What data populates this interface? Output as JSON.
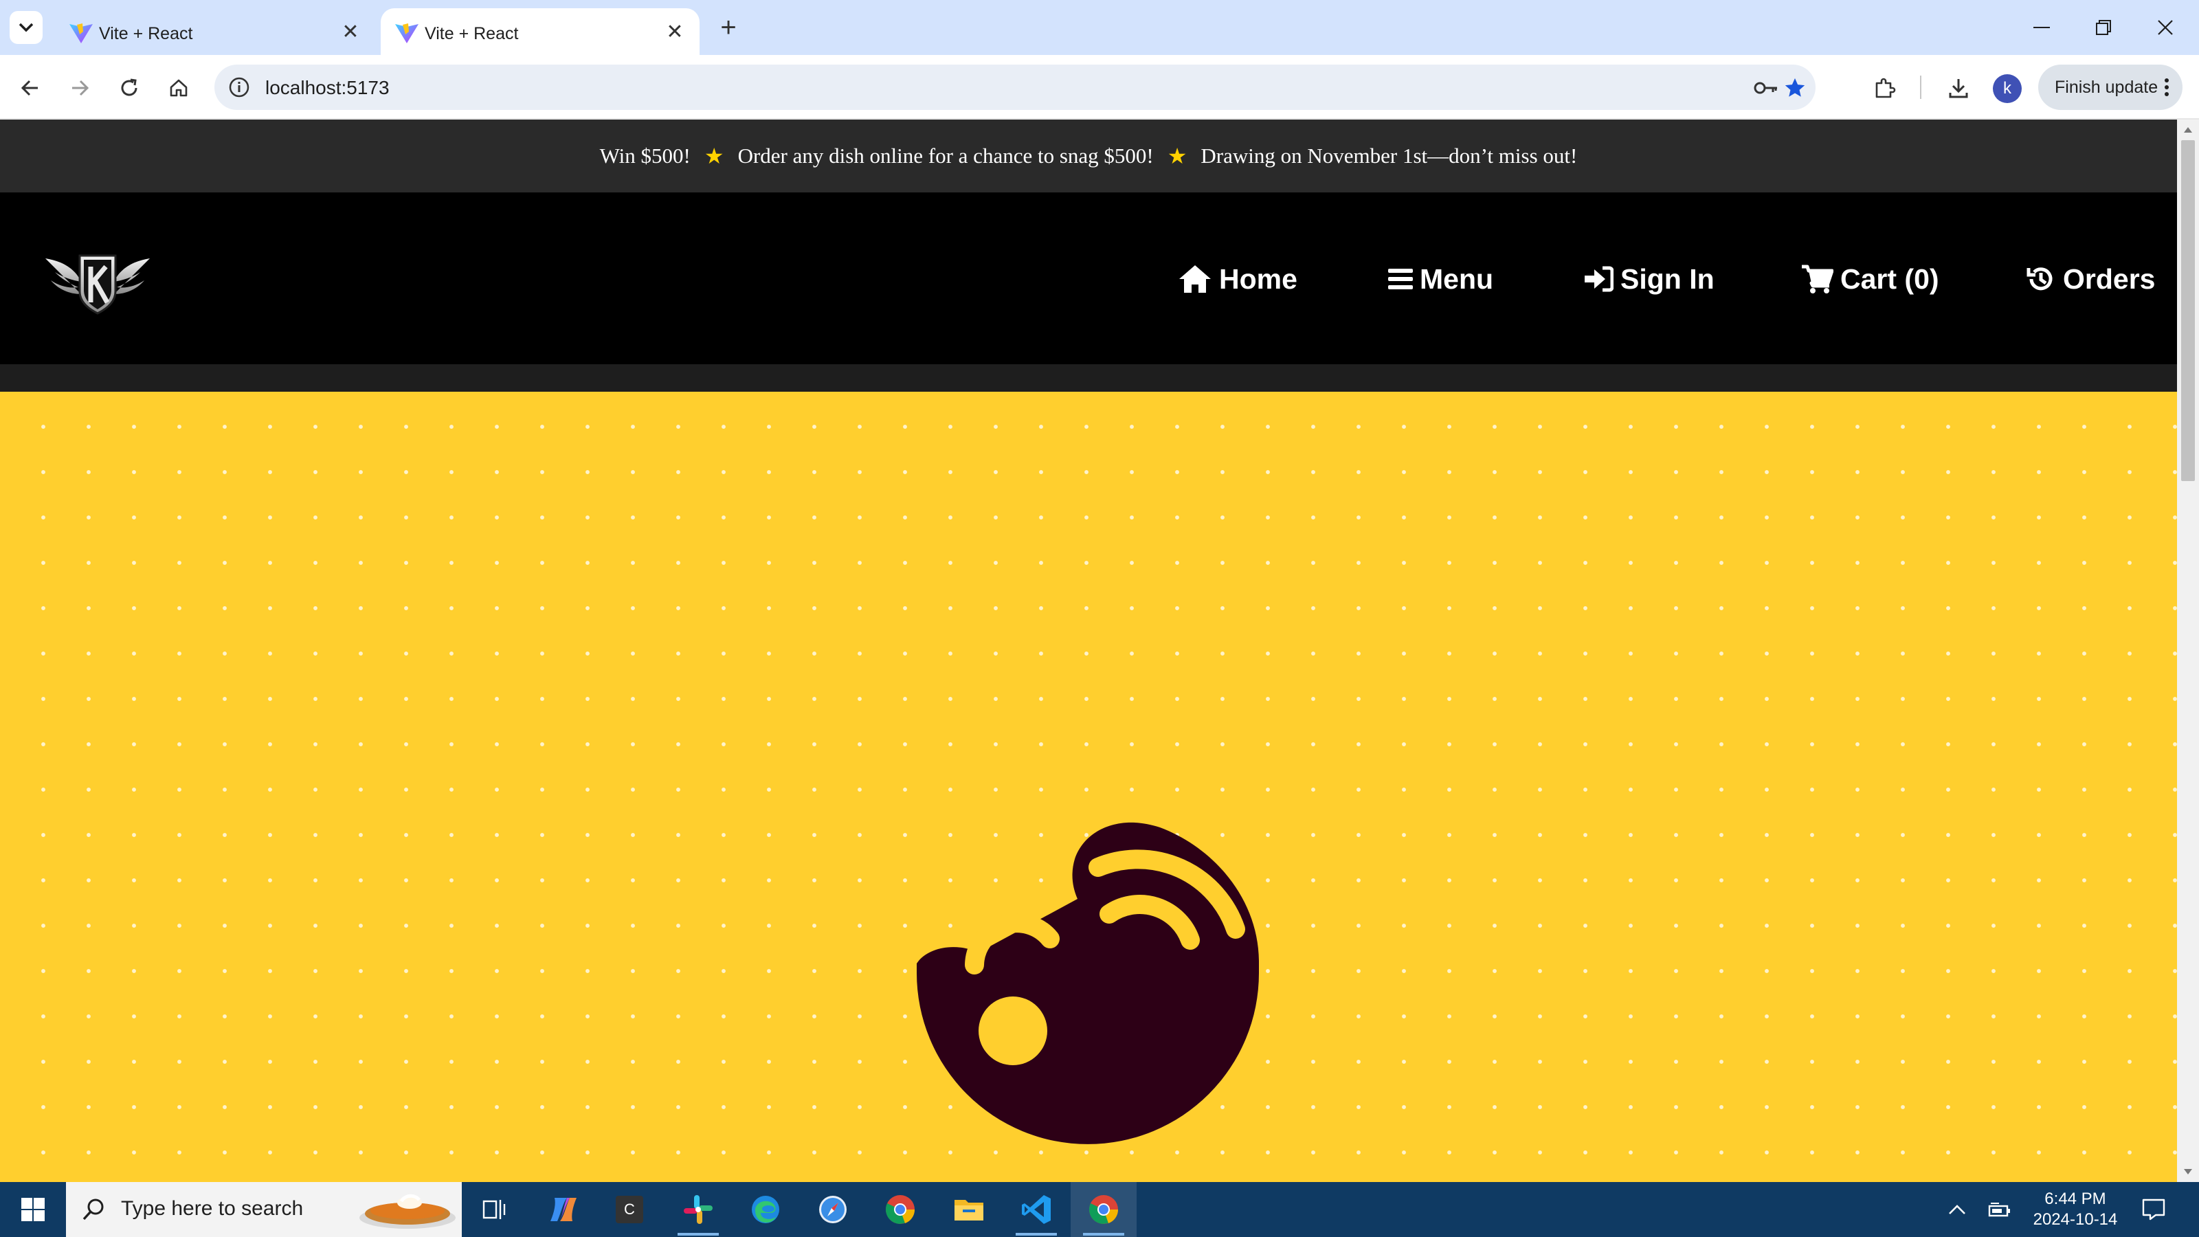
{
  "browser": {
    "tabs": [
      {
        "title": "Vite + React",
        "active": false
      },
      {
        "title": "Vite + React",
        "active": true
      }
    ],
    "url": "localhost:5173",
    "profile_initial": "k",
    "finish_update_label": "Finish update"
  },
  "site": {
    "promo": {
      "part1": "Win $500!",
      "part2": "Order any dish online for a chance to snag $500!",
      "part3": "Drawing on November 1st—don’t miss out!",
      "star": "★"
    },
    "nav": [
      {
        "label": "Home",
        "icon": "home-icon"
      },
      {
        "label": "Menu",
        "icon": "bars-icon"
      },
      {
        "label": "Sign In",
        "icon": "sign-in-icon"
      },
      {
        "label": "Cart (0)",
        "icon": "cart-icon"
      },
      {
        "label": "Orders",
        "icon": "history-icon"
      }
    ],
    "colors": {
      "hero_background": "#ffcf2e",
      "bowl": "#2d0016",
      "promo_bar": "#2a2a2a",
      "nav_bar": "#000000"
    }
  },
  "taskbar": {
    "search_placeholder": "Type here to search",
    "apps": [
      "task-view-icon",
      "copilot-icon",
      "terminal-icon",
      "slack-icon",
      "edge-icon",
      "safari-icon",
      "chrome-icon",
      "file-explorer-icon",
      "vscode-icon",
      "chrome-icon"
    ],
    "terminal_letter": "C",
    "time": "6:44 PM",
    "date": "2024-10-14"
  }
}
